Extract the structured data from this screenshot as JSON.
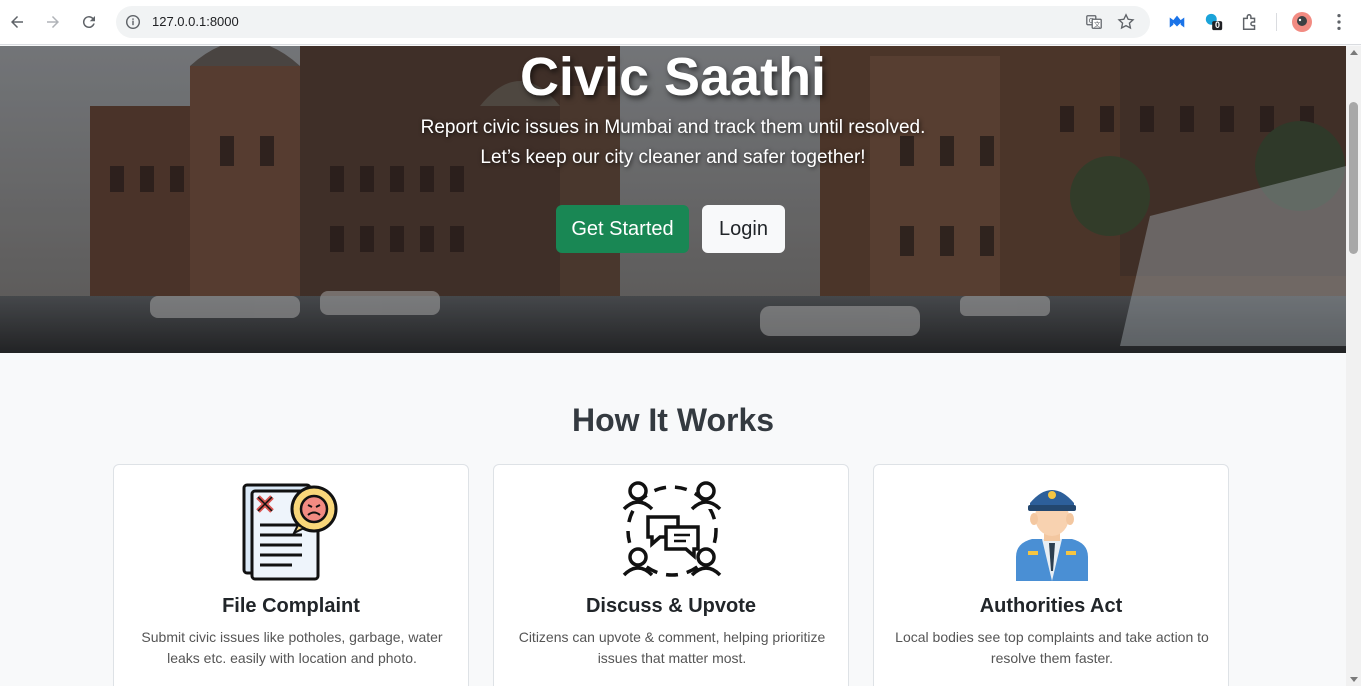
{
  "browser": {
    "url": "127.0.0.1:8000",
    "extension_badge": "0",
    "icons": [
      "back-icon",
      "forward-icon",
      "reload-icon",
      "site-info-icon",
      "translate-icon",
      "bookmark-star-icon",
      "malwarebytes-icon",
      "extension-badge-icon",
      "extensions-puzzle-icon",
      "profile-avatar",
      "menu-kebab-icon"
    ]
  },
  "hero": {
    "title": "Civic Saathi",
    "subtitle_line1": "Report civic issues in Mumbai and track them until resolved.",
    "subtitle_line2": "Let’s keep our city cleaner and safer together!",
    "cta_primary": "Get Started",
    "cta_secondary": "Login"
  },
  "how_it_works": {
    "title": "How It Works",
    "cards": [
      {
        "title": "File Complaint",
        "text": "Submit civic issues like potholes, garbage, water leaks etc. easily with location and photo.",
        "icon": "complaint-document-icon"
      },
      {
        "title": "Discuss & Upvote",
        "text": "Citizens can upvote & comment, helping prioritize issues that matter most.",
        "icon": "discussion-people-icon"
      },
      {
        "title": "Authorities Act",
        "text": "Local bodies see top complaints and take action to resolve them faster.",
        "icon": "police-officer-icon"
      }
    ]
  },
  "colors": {
    "primary_green": "#198754",
    "light_button": "#f8f9fa",
    "page_bg": "#f8f9fa"
  }
}
